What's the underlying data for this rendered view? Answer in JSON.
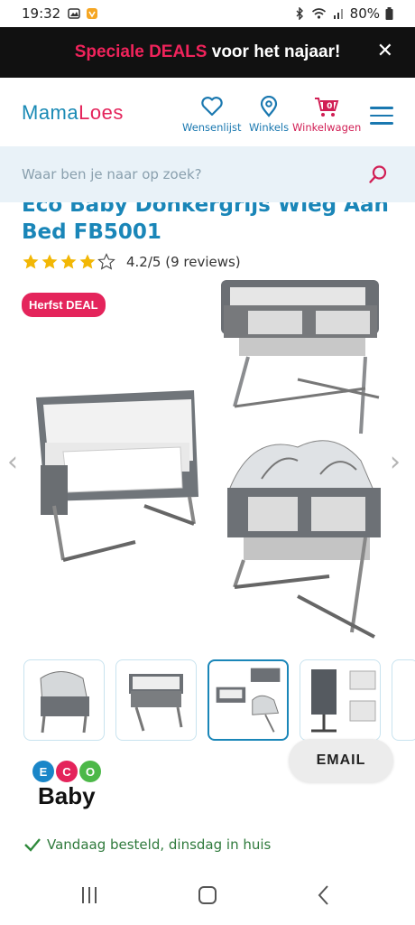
{
  "status_bar": {
    "time": "19:32",
    "battery": "80%"
  },
  "promo": {
    "highlight": "Speciale DEALS",
    "rest": " voor het najaar!",
    "close": "✕"
  },
  "header": {
    "logo_mama": "Mama",
    "logo_loes": "Loes",
    "wishlist_label": "Wensenlijst",
    "stores_label": "Winkels",
    "cart_label": "Winkelwagen",
    "cart_count": "0"
  },
  "search": {
    "placeholder": "Waar ben je naar op zoek?"
  },
  "product": {
    "title": "Eco Baby Donkergrijs Wieg Aan Bed FB5001",
    "rating_value": 4.2,
    "rating_text": "4.2/5 (9 reviews)",
    "badge": "Herfst DEAL"
  },
  "gallery": {
    "prev": "‹",
    "next": "›",
    "thumbnail_count": 5,
    "active_index": 2
  },
  "brand": {
    "letters": [
      "E",
      "C",
      "O"
    ],
    "name": "Baby"
  },
  "email_button": "EMAIL",
  "delivery": "Vandaag besteld, dinsdag in huis",
  "colors": {
    "brand_blue": "#1a86b8",
    "brand_pink": "#e4245b",
    "promo_bg": "#111111",
    "search_bg": "#e9f2f8"
  }
}
